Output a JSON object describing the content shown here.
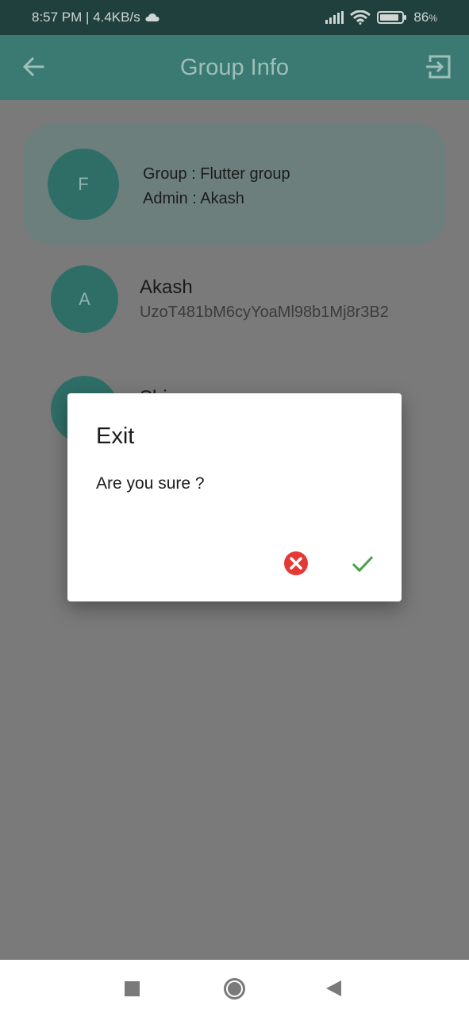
{
  "status_bar": {
    "time_speed": "8:57 PM | 4.4KB/s",
    "battery": "86",
    "battery_unit": "%",
    "icons": [
      "cloud-icon",
      "signal-icon",
      "wifi-icon",
      "battery-icon"
    ]
  },
  "app_bar": {
    "title": "Group Info",
    "back_icon": "arrow-left-icon",
    "exit_icon": "exit-to-app-icon"
  },
  "group": {
    "avatar_letter": "F",
    "name_line": "Group : Flutter group",
    "admin_line": "Admin : Akash"
  },
  "members": [
    {
      "avatar_letter": "A",
      "name": "Akash",
      "id": "UzoT481bM6cyYoaMl98b1Mj8r3B2"
    },
    {
      "avatar_letter": "",
      "name": "Shi",
      "id": ""
    }
  ],
  "dialog": {
    "title": "Exit",
    "message": "Are you sure ?",
    "cancel_icon": "cancel-icon",
    "confirm_icon": "check-icon"
  },
  "colors": {
    "app_bar": "#3a7a72",
    "status_bar": "#1f403c",
    "avatar": "#2f6e67",
    "cancel": "#e53935",
    "confirm": "#43a047",
    "scrim": "#7a7a7a"
  },
  "nav_bar": {
    "icons": [
      "recents-icon",
      "home-icon",
      "back-icon"
    ]
  }
}
